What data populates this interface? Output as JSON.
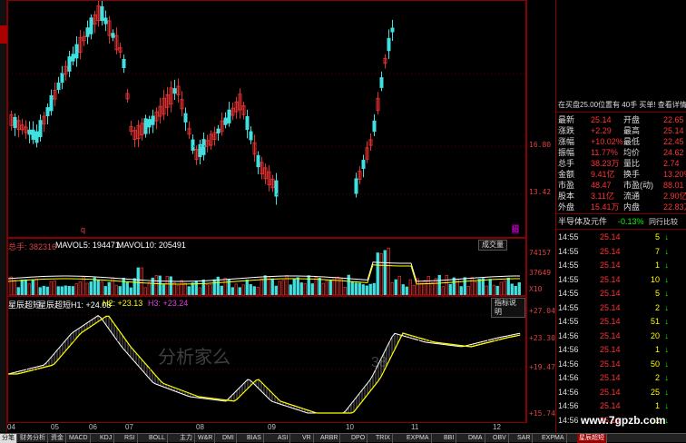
{
  "chart_data": {
    "type": "candlestick",
    "x_months": [
      "04",
      "05",
      "06",
      "07",
      "08",
      "09",
      "10",
      "11",
      "12"
    ],
    "price_axis": [
      "16.80",
      "13.42"
    ],
    "volume_axis": [
      "74157",
      "37649",
      "X10"
    ],
    "indicator_axis": [
      "+27.04",
      "+23.30",
      "+19.47",
      "+15.74"
    ],
    "volume_header": {
      "label": "总手: 382316",
      "ma5": "MAVOL5: 194471",
      "ma10": "MAVOL10: 205491"
    },
    "indicator_header": {
      "name": "星辰超短",
      "h1": "星辰超短H1: +24.08",
      "h2": "H2: +23.13",
      "h3": "H3: +23.24"
    }
  },
  "ui": {
    "chengjiaoliang": "成交量",
    "zhibiao_shuoming": "指标说明",
    "marker_q": "q",
    "marker_right": "招"
  },
  "quote": {
    "header": "在买盘25.00位置有  40手  买单! 查看详情",
    "rows": [
      [
        "最新",
        "25.14",
        "开盘",
        "22.65"
      ],
      [
        "涨跌",
        "+2.29",
        "最高",
        "25.14"
      ],
      [
        "涨幅",
        "+10.02%",
        "最低",
        "22.45"
      ],
      [
        "振幅",
        "11.77%",
        "均价",
        "24.62"
      ],
      [
        "总手",
        "38.23万",
        "量比",
        "2.74"
      ],
      [
        "金额",
        "9.41亿",
        "换手",
        "13.20%"
      ],
      [
        "市盈",
        "48.47",
        "市盈(动)",
        "88.01"
      ],
      [
        "股本",
        "3.11亿",
        "流通",
        "2.90亿"
      ],
      [
        "外盘",
        "15.41万",
        "内盘",
        "22.83万"
      ]
    ],
    "sector": "半导体及元件",
    "sector_chg": "-0.13%",
    "compare": "同行比较"
  },
  "ticks": [
    [
      "14:55",
      "25.14",
      "5"
    ],
    [
      "14:55",
      "25.14",
      "7"
    ],
    [
      "14:55",
      "25.14",
      "1"
    ],
    [
      "14:55",
      "25.14",
      "10"
    ],
    [
      "14:55",
      "25.14",
      "5"
    ],
    [
      "14:55",
      "25.14",
      "2"
    ],
    [
      "14:55",
      "25.14",
      "51"
    ],
    [
      "14:56",
      "25.14",
      "20"
    ],
    [
      "14:56",
      "25.14",
      "1"
    ],
    [
      "14:56",
      "25.14",
      "50"
    ],
    [
      "14:56",
      "25.14",
      "2"
    ],
    [
      "14:56",
      "25.14",
      "25"
    ],
    [
      "14:56",
      "25.14",
      "1"
    ],
    [
      "14:56",
      "25.14",
      "1"
    ]
  ],
  "watermark": "分析家么",
  "watermark2": "38",
  "site": "www.7gpzb.com",
  "tabs": [
    "分笔",
    "财务分析",
    "资金",
    "MACD",
    "KDJ",
    "RSI",
    "BOLL",
    "主力",
    "W&R",
    "DMI",
    "BIAS",
    "ASI",
    "VR",
    "ARBR",
    "DPO",
    "TRIX",
    "EXPMA",
    "BBI",
    "DMA",
    "OBV",
    "SAR",
    "EXPMA",
    "星辰超短"
  ]
}
